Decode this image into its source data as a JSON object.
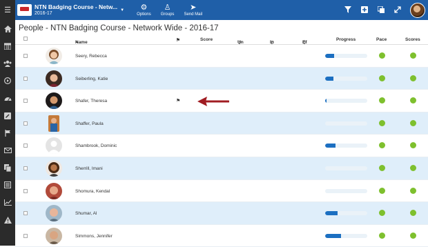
{
  "topbar": {
    "menu_icon": "hamburger-icon",
    "course_title": "NTN Badging Course - Netw...",
    "course_year": "2016-17",
    "tools": [
      {
        "label": "Options",
        "icon": "gears-icon"
      },
      {
        "label": "Groups",
        "icon": "groups-icon"
      },
      {
        "label": "Send Mail",
        "icon": "send-icon"
      }
    ],
    "right_icons": [
      "filter-icon",
      "add-icon",
      "copy-icon",
      "expand-icon"
    ]
  },
  "sidebar": {
    "icons": [
      "home-icon",
      "calendar-icon",
      "people-icon",
      "play-icon",
      "dashboard-icon",
      "edit-icon",
      "flag-icon",
      "mail-icon",
      "documents-icon",
      "list-icon",
      "chart-icon",
      "alert-icon"
    ]
  },
  "page": {
    "title": "People - NTN Badging Course - Network Wide - 2016-17"
  },
  "table": {
    "headers": {
      "name": "Name",
      "sort_indicator": "▲",
      "score": "Score",
      "un": "Un",
      "in": "In",
      "ef": "Ef",
      "progress": "Progress",
      "pace": "Pace",
      "scores": "Scores"
    },
    "rows": [
      {
        "name": "Seery, Rebecca",
        "flagged": false,
        "progress": 0.22
      },
      {
        "name": "Seiberling, Katie",
        "flagged": false,
        "progress": 0.2
      },
      {
        "name": "Shafer, Theresa",
        "flagged": true,
        "progress": 0.03
      },
      {
        "name": "Shaffer, Paula",
        "flagged": false,
        "progress": 0.0
      },
      {
        "name": "Shambrook, Dominic",
        "flagged": false,
        "progress": 0.24
      },
      {
        "name": "Sherrill, Imani",
        "flagged": false,
        "progress": 0.0
      },
      {
        "name": "Shomura, Kendal",
        "flagged": false,
        "progress": 0.0
      },
      {
        "name": "Shumar, Al",
        "flagged": false,
        "progress": 0.3
      },
      {
        "name": "Simmons, Jennifer",
        "flagged": false,
        "progress": 0.38
      }
    ]
  },
  "colors": {
    "topbar": "#1f5fa8",
    "sidebar": "#2b2b2b",
    "row_alt": "#dfeefa",
    "progress_fill": "#1c6fc1",
    "status_dot": "#7ec02e",
    "arrow": "#a01c22"
  }
}
